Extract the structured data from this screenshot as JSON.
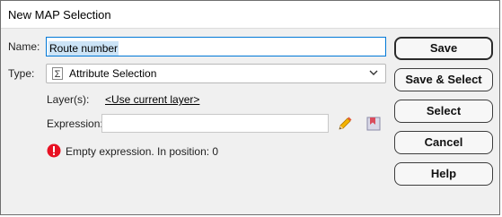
{
  "window": {
    "title": "New MAP Selection"
  },
  "form": {
    "name_label": "Name:",
    "name_value": "Route number",
    "type_label": "Type:",
    "type_value": "Attribute Selection",
    "type_icon": "sigma-icon",
    "layers_label": "Layer(s):",
    "layers_link": "<Use current layer>",
    "expression_label": "Expression:",
    "expression_value": "",
    "edit_icon": "pencil-icon",
    "library_icon": "bookmark-icon"
  },
  "status": {
    "icon": "error-icon",
    "message": "Empty expression. In position: 0",
    "color": "#e81123"
  },
  "buttons": {
    "save": "Save",
    "save_select": "Save & Select",
    "select": "Select",
    "cancel": "Cancel",
    "help": "Help"
  },
  "colors": {
    "accent": "#0078d7",
    "error": "#e81123"
  }
}
